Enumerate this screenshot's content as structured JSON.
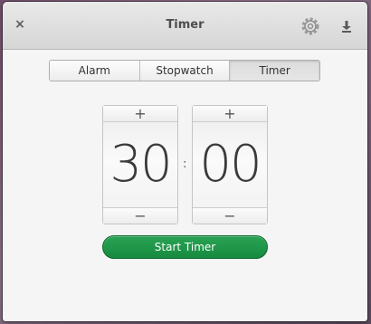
{
  "window": {
    "title": "Timer",
    "close_glyph": "×",
    "settings_icon": "gear-icon",
    "download_icon": "download-icon"
  },
  "mode_switch": {
    "tabs": [
      {
        "label": "Alarm",
        "active": false
      },
      {
        "label": "Stopwatch",
        "active": false
      },
      {
        "label": "Timer",
        "active": true
      }
    ]
  },
  "timer": {
    "minutes": "30",
    "seconds": "00",
    "separator": ":",
    "increment_glyph": "+",
    "decrement_glyph": "−"
  },
  "actions": {
    "start_label": "Start Timer"
  },
  "colors": {
    "accent": "#1a8f43",
    "window_bg": "#f5f5f5"
  }
}
